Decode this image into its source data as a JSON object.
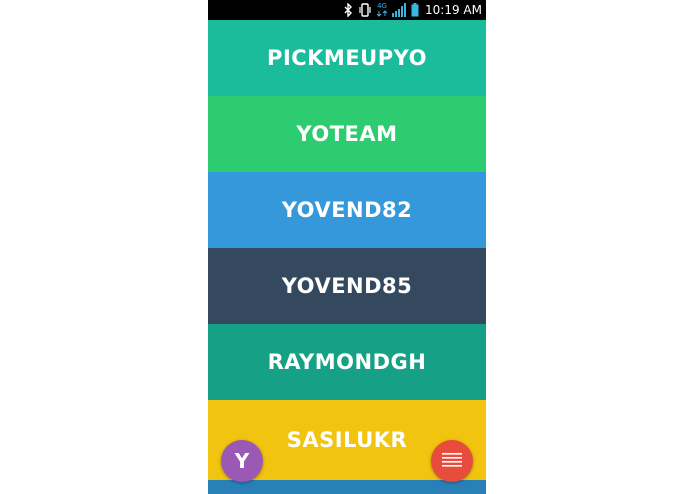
{
  "status_bar": {
    "network_label": "4G",
    "time": "10:19 AM",
    "icons": [
      "bluetooth-icon",
      "vibrate-icon",
      "network-4g-icon",
      "signal-icon",
      "battery-icon"
    ]
  },
  "contacts": [
    {
      "name": "PICKMEUPYO",
      "color": "#1abc9c"
    },
    {
      "name": "YOTEAM",
      "color": "#2ecc71"
    },
    {
      "name": "YOVEND82",
      "color": "#3498db"
    },
    {
      "name": "YOVEND85",
      "color": "#34495e"
    },
    {
      "name": "RAYMONDGH",
      "color": "#16a085"
    },
    {
      "name": "SASILUKR",
      "color": "#f1c40f"
    }
  ],
  "next_row_color": "#2980b9",
  "profile_button": {
    "letter": "Y",
    "color": "#9b59b6"
  },
  "menu_button": {
    "icon": "hamburger-menu-icon",
    "color": "#e74c3c"
  }
}
